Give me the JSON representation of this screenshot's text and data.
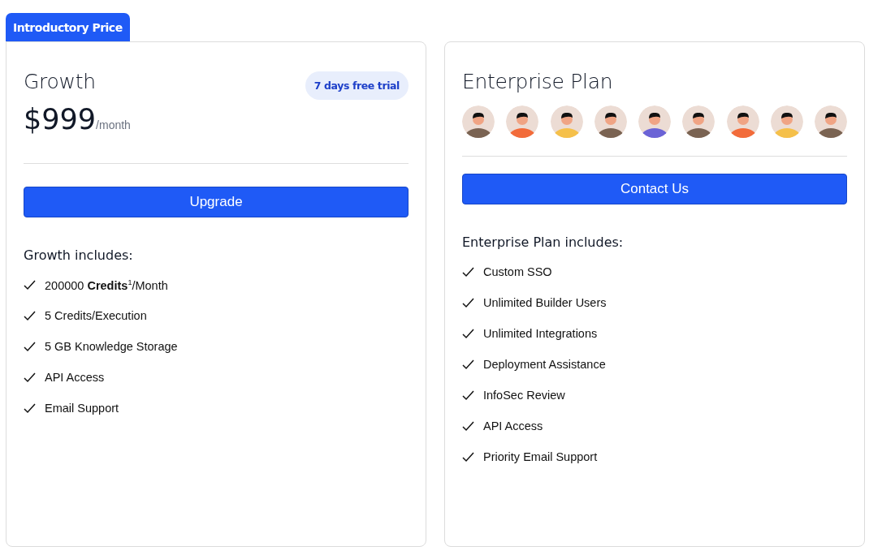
{
  "tab": {
    "label": "Introductory Price"
  },
  "plans": [
    {
      "kind": "price",
      "name": "Growth",
      "badge": "7 days free trial",
      "price": "$999",
      "period": "/month",
      "button": "Upgrade",
      "includes_title": "Growth includes:",
      "features": [
        "200000 **Credits**$^{1}$/Month",
        "5 Credits/Execution",
        "5 GB Knowledge Storage",
        "API Access",
        "Email Support"
      ]
    },
    {
      "kind": "avatars",
      "name": "Enterprise Plan",
      "avatars": [
        {
          "color": "#7a6352"
        },
        {
          "color": "#f26b3a"
        },
        {
          "color": "#f5c04a"
        },
        {
          "color": "#7a6352"
        },
        {
          "color": "#6b63d6"
        },
        {
          "color": "#7a6352"
        },
        {
          "color": "#f26b3a"
        },
        {
          "color": "#f5c04a"
        },
        {
          "color": "#7a6352"
        }
      ],
      "button": "Contact Us",
      "includes_title": "Enterprise Plan includes:",
      "features": [
        "Custom SSO",
        "Unlimited Builder Users",
        "Unlimited Integrations",
        "Deployment Assistance",
        "InfoSec Review",
        "API Access",
        "Priority Email Support"
      ]
    }
  ]
}
